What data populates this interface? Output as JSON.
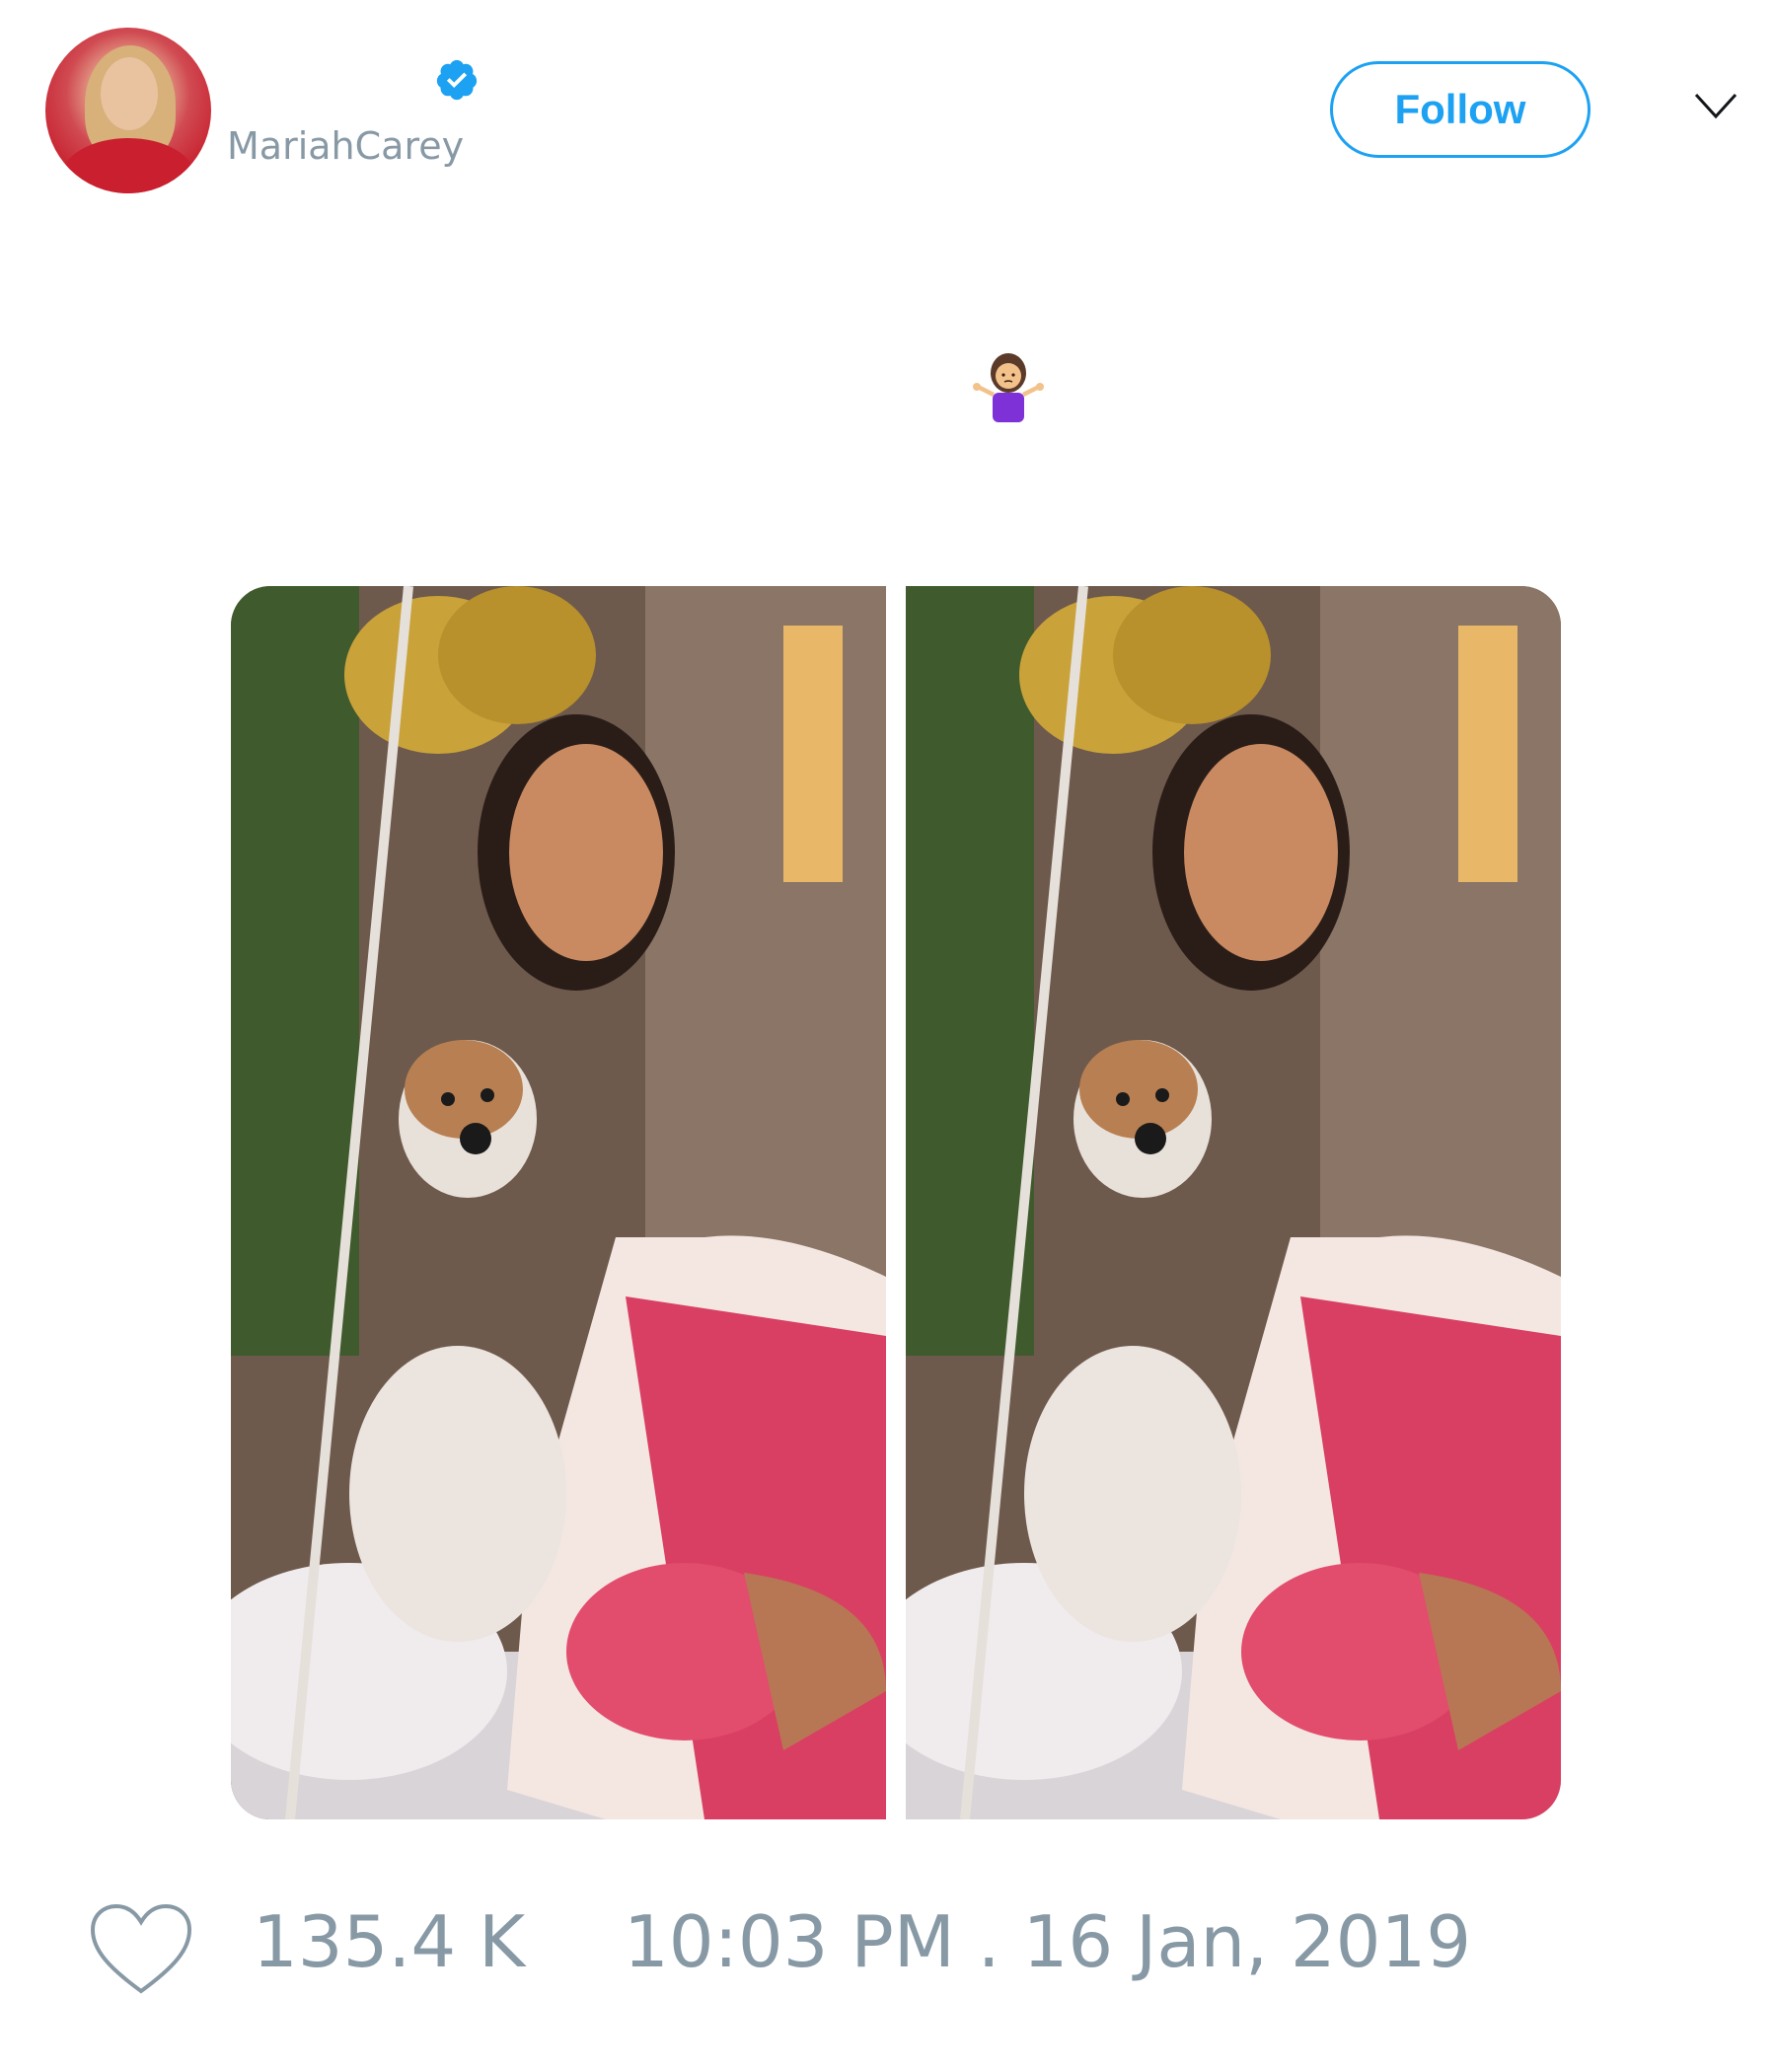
{
  "tweet": {
    "author": {
      "display_name": "",
      "username": "MariahCarey",
      "verified": true
    },
    "follow_label": "Follow",
    "text_emoji": "🤷‍♀️",
    "media": [
      {
        "description_icon": "photo"
      },
      {
        "description_icon": "photo"
      }
    ],
    "likes": "135.4 K",
    "timestamp": "10:03 PM . 16 Jan, 2019"
  },
  "colors": {
    "accent": "#1da1f2",
    "muted": "#8899a6",
    "text": "#14171a"
  }
}
